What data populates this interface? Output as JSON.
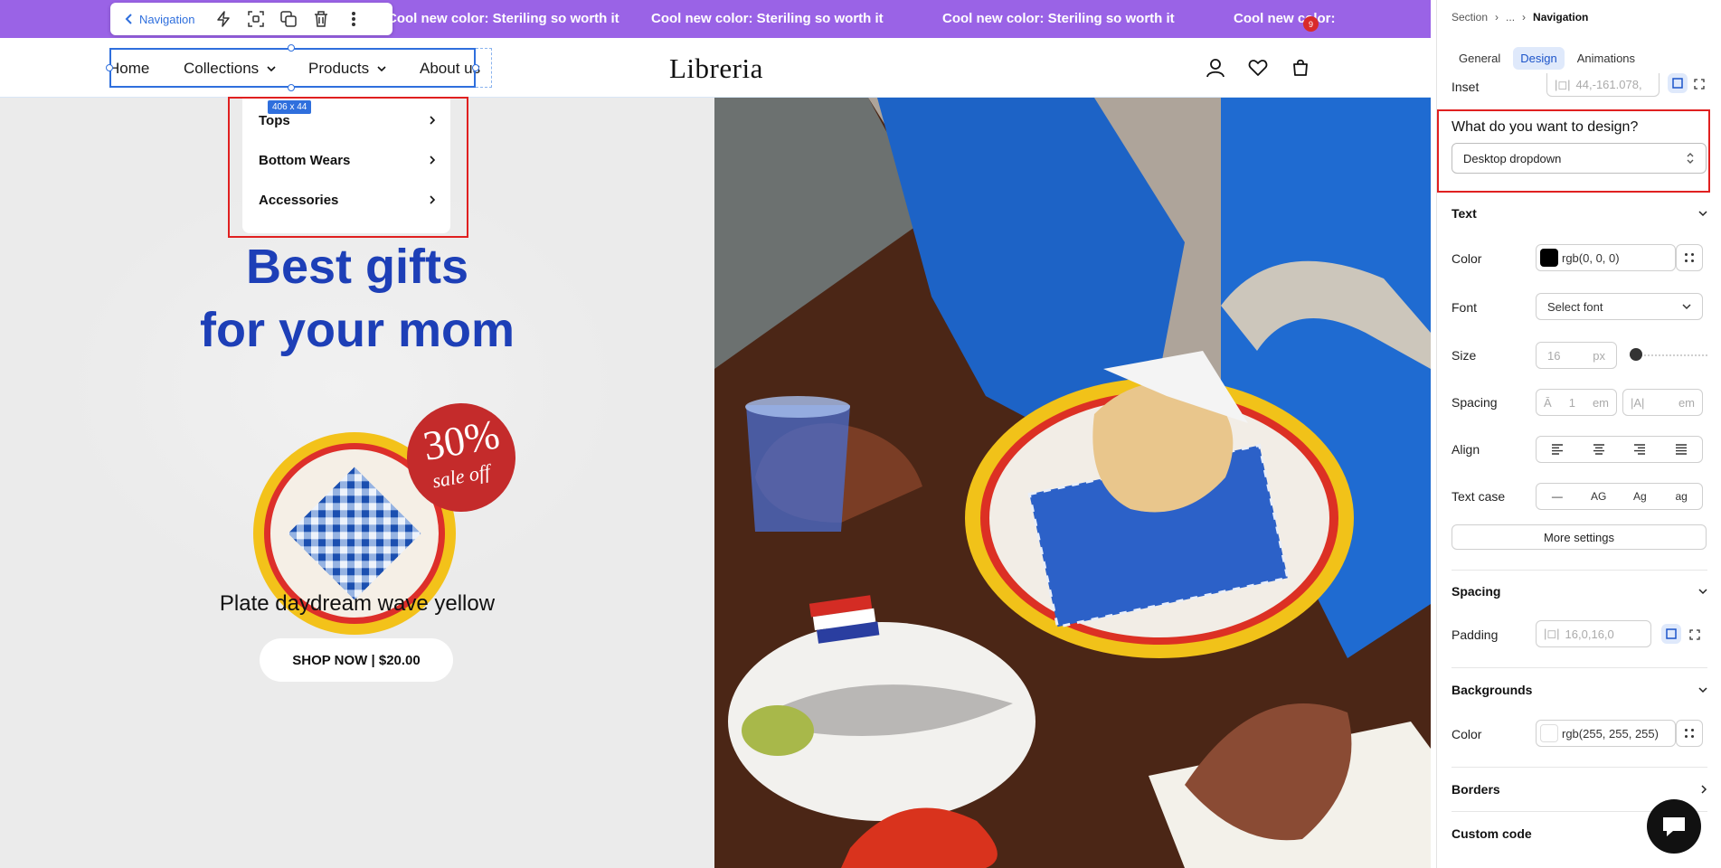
{
  "editor": {
    "floating_toolbar": {
      "back_label": "Navigation"
    },
    "selection_size": "406 x 44"
  },
  "store": {
    "announcement": [
      "Cool new color: Steriling so worth it",
      "Cool new color: Steriling so worth it",
      "Cool new color: Steriling so worth it",
      "Cool new color:"
    ],
    "nav": {
      "items": [
        "Home",
        "Collections",
        "Products",
        "About us"
      ],
      "logo": "Libreria",
      "cart_count": "9"
    },
    "dropdown": {
      "items": [
        "Tops",
        "Bottom Wears",
        "Accessories"
      ]
    },
    "hero": {
      "title_line1": "Best gifts",
      "title_line2": "for your mom",
      "sale_percent": "30%",
      "sale_text": "sale off",
      "product_name": "Plate daydream wave yellow",
      "button_label": "SHOP NOW | $20.00"
    }
  },
  "panel": {
    "breadcrumb": [
      "Section",
      "...",
      "Navigation"
    ],
    "tabs": [
      "General",
      "Design",
      "Animations"
    ],
    "active_tab": "Design",
    "inset": {
      "label": "Inset",
      "value": "44,-161.078,"
    },
    "design_question": "What do you want to design?",
    "design_select": "Desktop dropdown",
    "text_section": {
      "title": "Text",
      "color_label": "Color",
      "color_value": "rgb(0, 0, 0)",
      "font_label": "Font",
      "font_value": "Select font",
      "size_label": "Size",
      "size_value": "16",
      "size_unit": "px",
      "spacing_label": "Spacing",
      "letter_spacing": "1",
      "spacing_unit": "em",
      "line_spacing_unit": "em",
      "align_label": "Align",
      "case_label": "Text case",
      "case_options": [
        "—",
        "AG",
        "Ag",
        "ag"
      ],
      "more_settings": "More settings"
    },
    "spacing_section": {
      "title": "Spacing",
      "padding_label": "Padding",
      "padding_value": "16,0,16,0"
    },
    "backgrounds_section": {
      "title": "Backgrounds",
      "color_label": "Color",
      "color_value": "rgb(255, 255, 255)"
    },
    "borders_title": "Borders",
    "custom_code_title": "Custom code"
  },
  "colors": {
    "announcement_bg": "#9a63e6",
    "hero_title": "#1d3fb7",
    "accent_blue": "#2f6fdd",
    "highlight_red": "#e02020",
    "sale_badge": "#c42b2b"
  }
}
